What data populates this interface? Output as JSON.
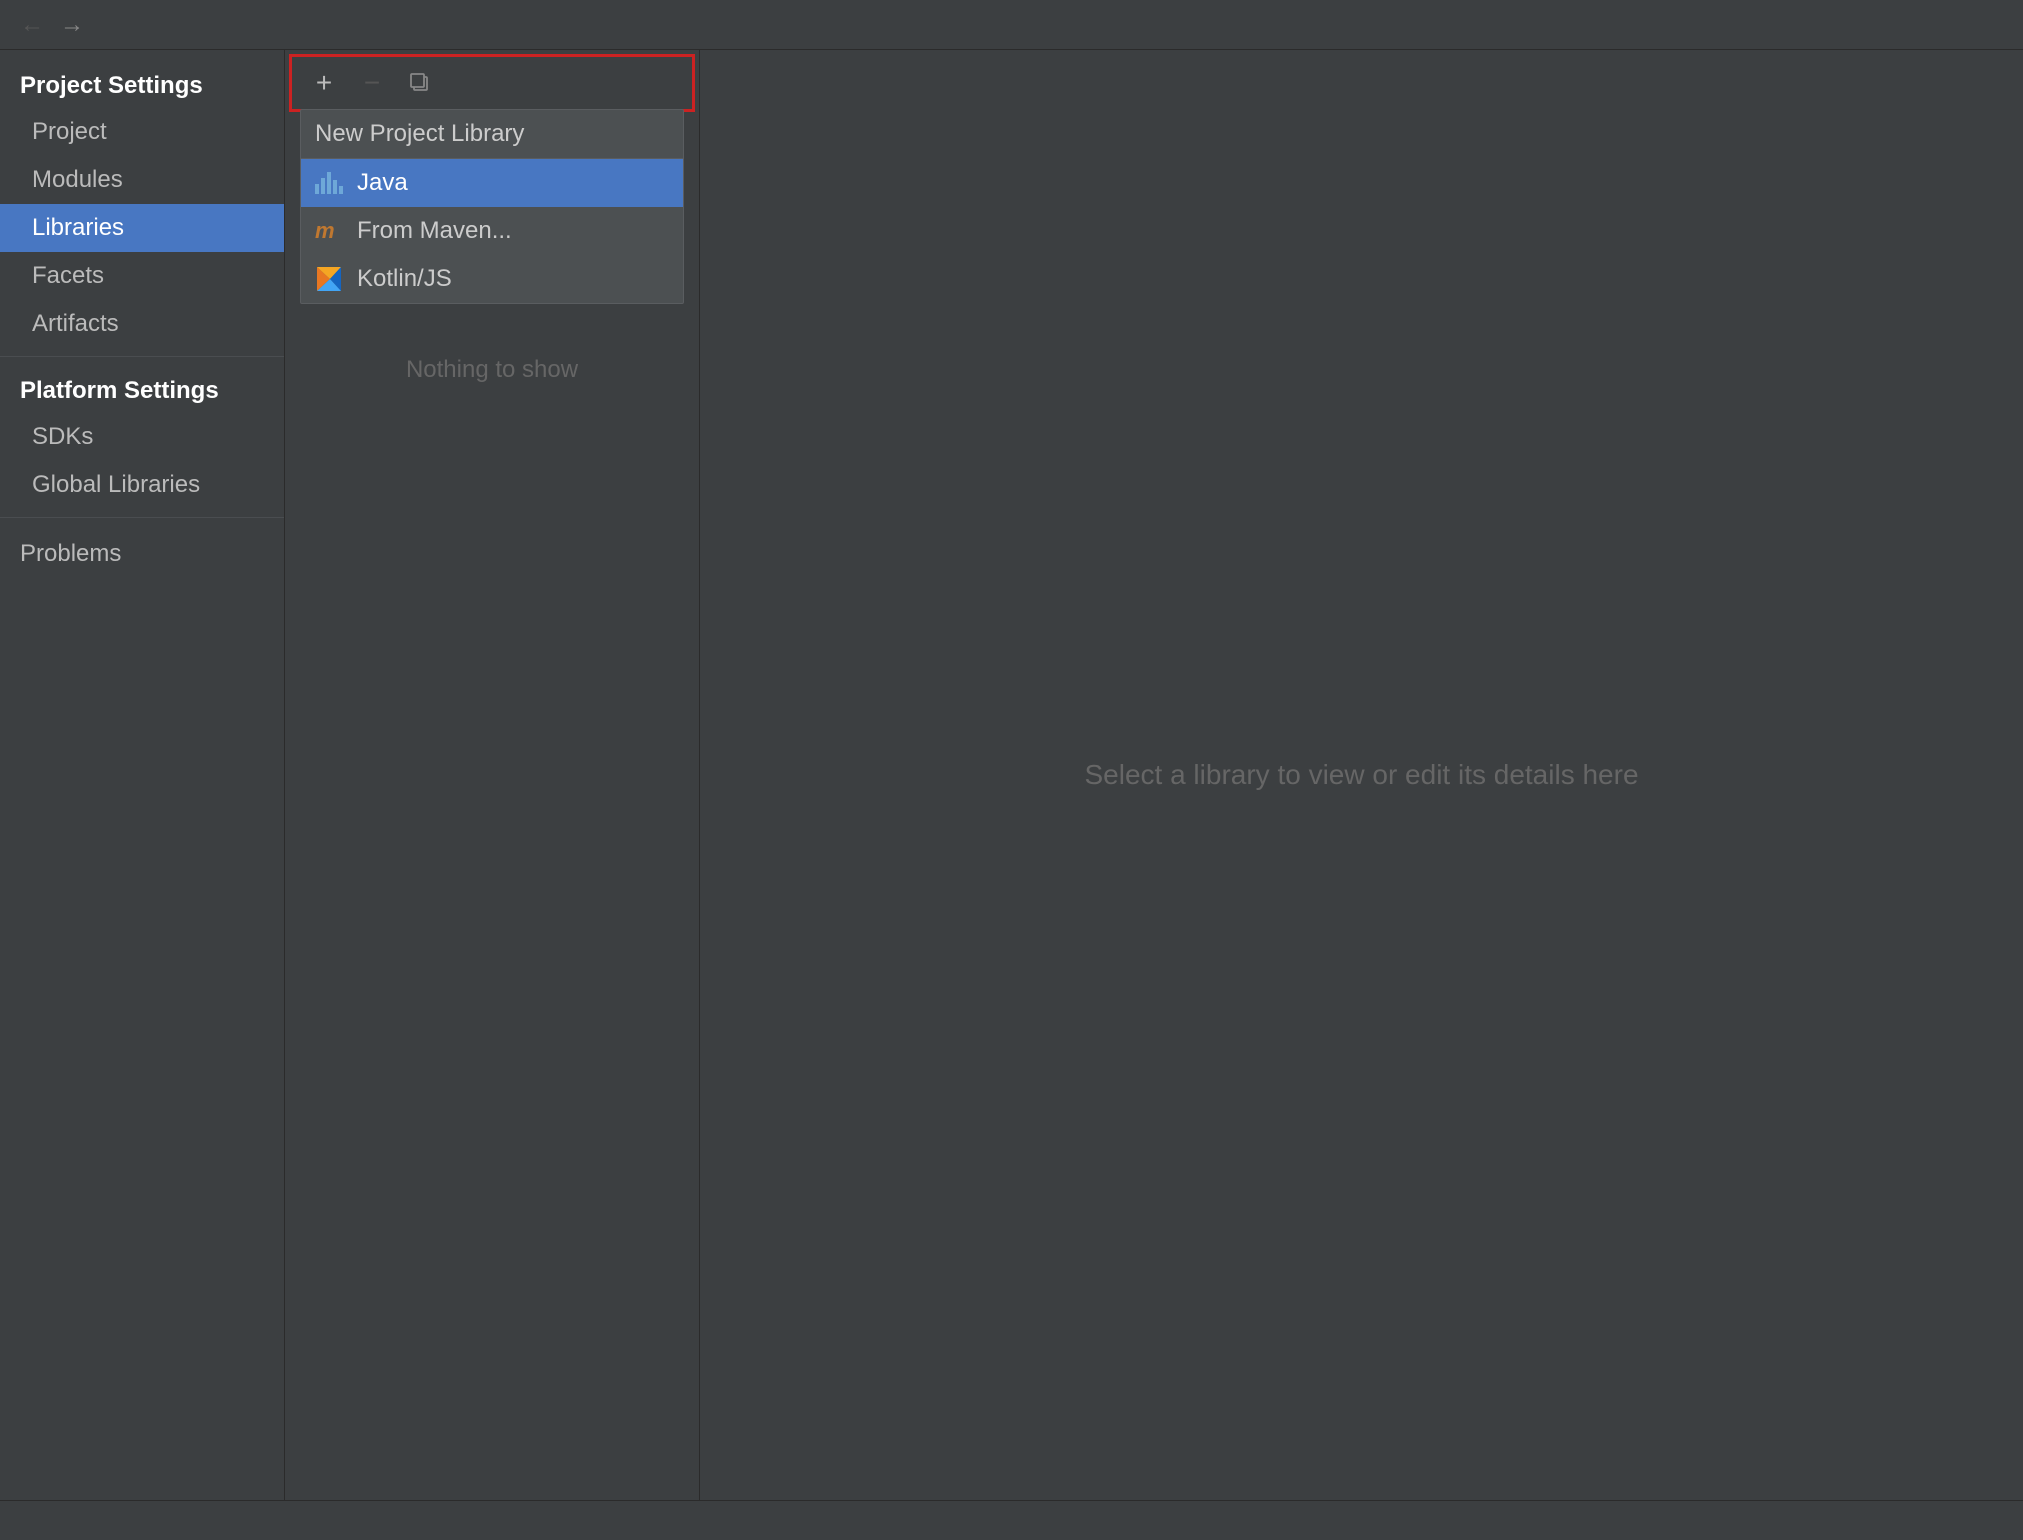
{
  "topBar": {
    "backArrow": "←",
    "forwardArrow": "→"
  },
  "sidebar": {
    "projectSettingsTitle": "Project Settings",
    "projectSettingsItems": [
      {
        "label": "Project",
        "active": false
      },
      {
        "label": "Modules",
        "active": false
      },
      {
        "label": "Libraries",
        "active": true
      },
      {
        "label": "Facets",
        "active": false
      },
      {
        "label": "Artifacts",
        "active": false
      }
    ],
    "platformSettingsTitle": "Platform Settings",
    "platformSettingsItems": [
      {
        "label": "SDKs",
        "active": false
      },
      {
        "label": "Global Libraries",
        "active": false
      }
    ],
    "problemsLabel": "Problems"
  },
  "toolbar": {
    "addBtn": "+",
    "removeBtn": "−",
    "copyBtn": "⎘"
  },
  "dropdown": {
    "header": "New Project Library",
    "items": [
      {
        "label": "Java",
        "icon": "java-icon",
        "selected": true
      },
      {
        "label": "From Maven...",
        "icon": "maven-icon",
        "selected": false
      },
      {
        "label": "Kotlin/JS",
        "icon": "kotlin-icon",
        "selected": false
      }
    ]
  },
  "middlePanel": {
    "nothingToShow": "Nothing to show"
  },
  "rightPanel": {
    "message": "Select a library to view or edit its details here"
  }
}
